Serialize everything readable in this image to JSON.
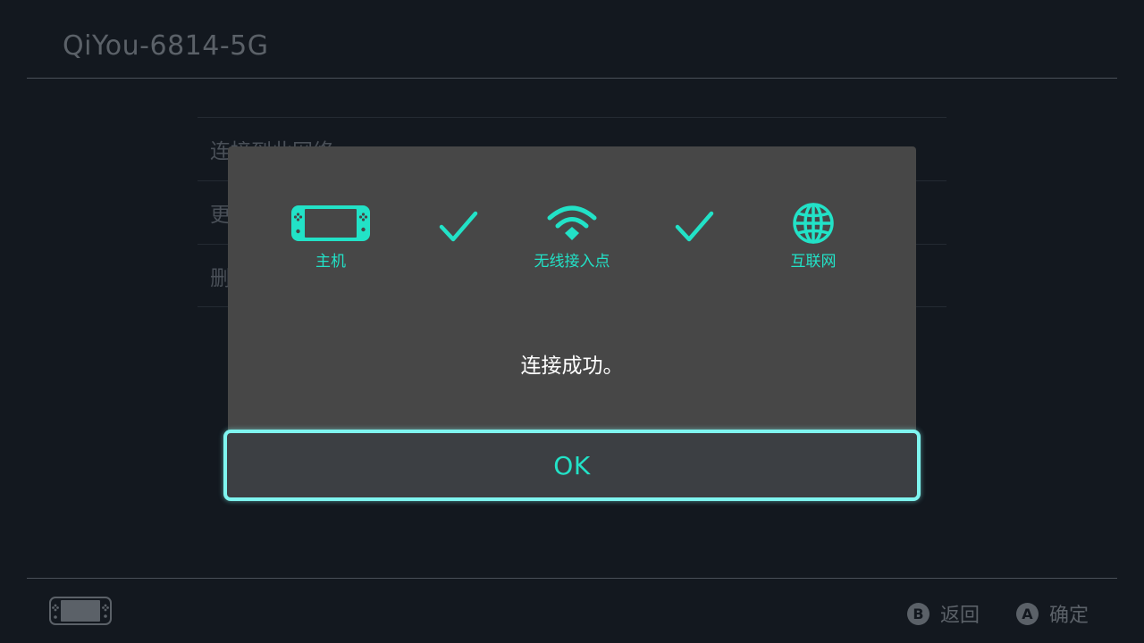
{
  "header": {
    "title": "QiYou-6814-5G"
  },
  "menu": {
    "items": [
      {
        "label": "连接到此网络"
      },
      {
        "label": "更"
      },
      {
        "label": "删"
      }
    ]
  },
  "dialog": {
    "stages": [
      {
        "label": "主机",
        "icon": "console-icon"
      },
      {
        "label": "无线接入点",
        "icon": "wifi-icon"
      },
      {
        "label": "互联网",
        "icon": "globe-icon"
      }
    ],
    "checks": [
      "check-icon",
      "check-icon"
    ],
    "message": "连接成功。",
    "ok_label": "OK"
  },
  "footer": {
    "back": {
      "key": "B",
      "label": "返回"
    },
    "confirm": {
      "key": "A",
      "label": "确定"
    }
  },
  "colors": {
    "background": "#13181f",
    "accent": "#22e2c7",
    "focus_border": "#7ff5f0",
    "dialog": "#474747",
    "dim_text": "#5b6168"
  }
}
